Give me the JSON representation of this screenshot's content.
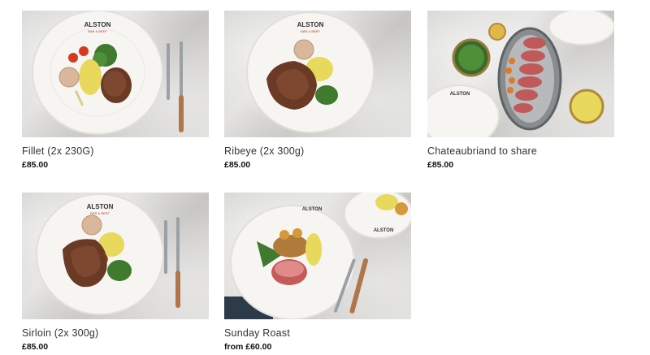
{
  "products": [
    {
      "name": "Fillet (2x 230G)",
      "price": "£85.00",
      "logo": "ALSTON"
    },
    {
      "name": "Ribeye (2x 300g)",
      "price": "£85.00",
      "logo": "ALSTON"
    },
    {
      "name": "Chateaubriand to share",
      "price": "£85.00",
      "logo": "ALSTON"
    },
    {
      "name": "Sirloin (2x 300g)",
      "price": "£85.00",
      "logo": "ALSTON"
    },
    {
      "name": "Sunday Roast",
      "price": "from £60.00",
      "logo": "ALSTON"
    }
  ],
  "colors": {
    "plate": "#f7f5f2",
    "steak": "#6b3a24",
    "greens": "#3f7a2e",
    "sauce": "#e9de6a"
  }
}
